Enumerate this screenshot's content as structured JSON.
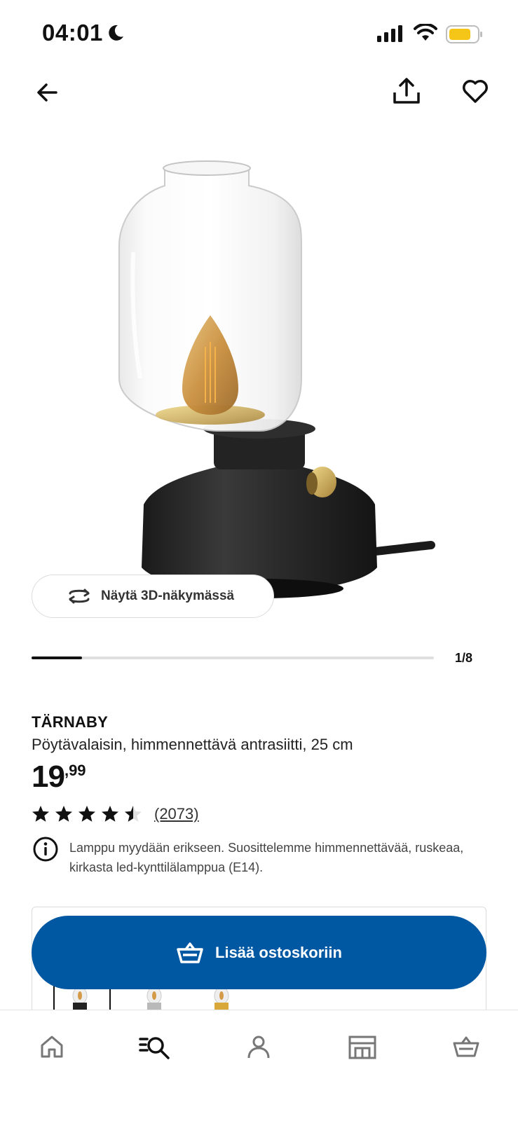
{
  "status_bar": {
    "time": "04:01",
    "icons": [
      "moon-icon",
      "signal-icon",
      "wifi-icon",
      "battery-icon"
    ],
    "battery_color": "#f5c518"
  },
  "top_nav": {
    "icons": [
      "back-arrow-icon",
      "share-icon",
      "heart-icon"
    ]
  },
  "gallery": {
    "view_3d_label": "Näytä 3D-näkymässä",
    "view_3d_icon": "rotate-3d-icon",
    "counter": "1/8",
    "current_index": 1,
    "total": 8
  },
  "product": {
    "name": "TÄRNABY",
    "description": "Pöytävalaisin, himmennettävä antrasiitti, 25 cm",
    "price_integer": "19",
    "price_decimal": ",99",
    "rating_value": 4.5,
    "rating_max": 5,
    "rating_count": "(2073)",
    "info_icon": "info-icon",
    "info_text": "Lamppu myydään erikseen. Suosittelemme himmennettävää, ruskeaa, kirkasta led-kynttilälamppua (E14)."
  },
  "cart": {
    "button_label": "Lisää ostoskoriin",
    "button_icon": "basket-icon",
    "button_color": "#0058a3"
  },
  "bottom_nav": {
    "items": [
      "home-icon",
      "search-icon",
      "profile-icon",
      "store-icon",
      "basket-icon"
    ],
    "active": "search-icon"
  }
}
